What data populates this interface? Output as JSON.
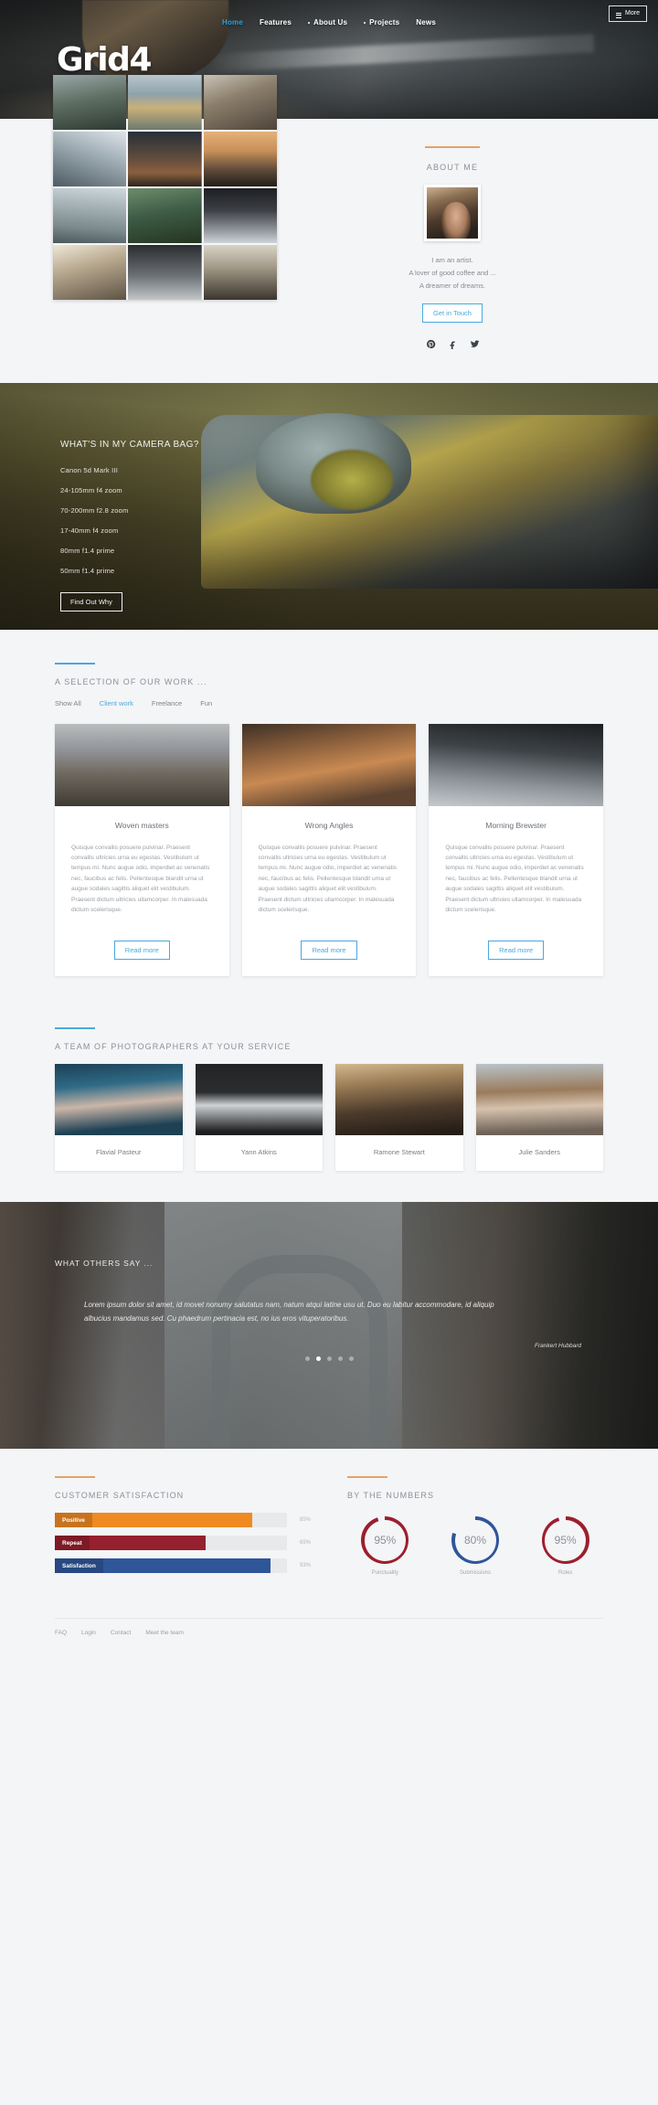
{
  "brand": "Grid4",
  "nav": {
    "items": [
      {
        "label": "Home",
        "active": true,
        "dot": false
      },
      {
        "label": "Features",
        "active": false,
        "dot": false
      },
      {
        "label": "About Us",
        "active": false,
        "dot": true
      },
      {
        "label": "Projects",
        "active": false,
        "dot": true
      },
      {
        "label": "News",
        "active": false,
        "dot": false
      }
    ],
    "more_label": "More"
  },
  "about": {
    "title": "ABOUT ME",
    "line1": "I am an artist.",
    "line2": "A lover of good coffee and ...",
    "line3": "A dreamer of dreams.",
    "cta": "Get in Touch",
    "socials": [
      "pinterest-icon",
      "facebook-icon",
      "twitter-icon"
    ]
  },
  "camerabag": {
    "title": "WHAT'S IN MY CAMERA BAG?",
    "items": [
      "Canon 5d Mark III",
      "24-105mm f4 zoom",
      "70-200mm f2.8 zoom",
      "17-40mm f4 zoom",
      "80mm f1.4 prime",
      "50mm f1.4 prime"
    ],
    "cta": "Find Out Why"
  },
  "portfolio": {
    "title": "A SELECTION OF OUR WORK ...",
    "filters": [
      {
        "label": "Show All",
        "active": false
      },
      {
        "label": "Client work",
        "active": true
      },
      {
        "label": "Freelance",
        "active": false
      },
      {
        "label": "Fun",
        "active": false
      }
    ],
    "body": "Quisque convallis posuere pulvinar. Praesent convallis ultricies urna eu egestas. Vestibulum ut tempus mi. Nunc augue odio, imperdiet ac venenatis nec, faucibus ac felis. Pellentesque blandit urna ut augue sodales sagittis aliquet elit vestibulum. Praesent dictum ultricies ullamcorper. In malesuada dictum scelerisque.",
    "read_more": "Read more",
    "cards": [
      {
        "title": "Woven masters"
      },
      {
        "title": "Wrong Angles"
      },
      {
        "title": "Morning Brewster"
      }
    ]
  },
  "team": {
    "title": "A TEAM OF PHOTOGRAPHERS AT YOUR SERVICE",
    "members": [
      {
        "name": "Flavial Pasteur"
      },
      {
        "name": "Yann Atkins"
      },
      {
        "name": "Ramone Stewart"
      },
      {
        "name": "Julie Sanders"
      }
    ]
  },
  "testimonial": {
    "title": "WHAT OTHERS SAY ...",
    "quote": "Lorem ipsum dolor sit amet, id movet nonumy salutatus nam, natum atqui latine usu ut. Duo eu labitur accommodare, id aliquip albucius mandamus sed. Cu phaedrum pertinacia est, no ius eros vituperatoribus.",
    "author": "Frankert Hubbard",
    "dots": 5,
    "active_dot": 1
  },
  "stats": {
    "satisfaction_title": "CUSTOMER SATISFACTION",
    "numbers_title": "BY THE NUMBERS",
    "bars": [
      {
        "label": "Positive",
        "value": 85,
        "pct_label": "85%",
        "color": "#ef8a22"
      },
      {
        "label": "Repeat",
        "value": 65,
        "pct_label": "65%",
        "color": "#95202e"
      },
      {
        "label": "Satisfaction",
        "value": 93,
        "pct_label": "93%",
        "color": "#2f5699"
      }
    ],
    "rings": [
      {
        "value": "95%",
        "label": "Punctuality",
        "pct": 95,
        "color": "#9c1f2e"
      },
      {
        "value": "80%",
        "label": "Submissions",
        "pct": 80,
        "color": "#2f5699"
      },
      {
        "value": "95%",
        "label": "Roles",
        "pct": 95,
        "color": "#9c1f2e"
      }
    ]
  },
  "footer": {
    "links": [
      "FAQ",
      "Login",
      "Contact",
      "Meet the team"
    ]
  },
  "colors": {
    "accent_blue": "#4aa8dd",
    "accent_orange": "#e2a26a",
    "bg": "#f4f5f7"
  }
}
